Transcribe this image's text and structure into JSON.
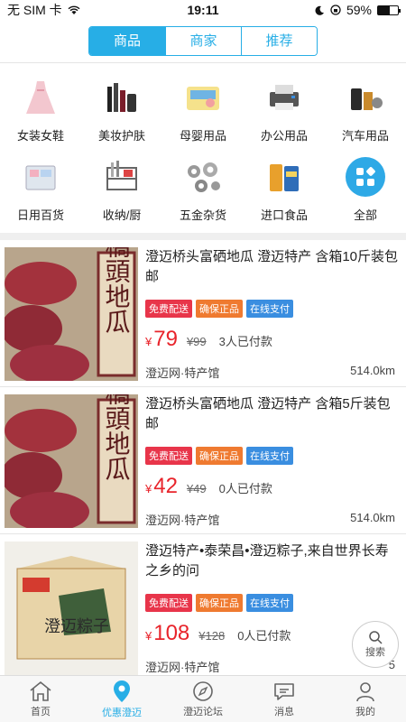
{
  "status_bar": {
    "carrier": "无 SIM 卡",
    "time": "19:11",
    "battery": "59%",
    "battery_level": 0.59
  },
  "segments": [
    {
      "label": "商品",
      "active": true
    },
    {
      "label": "商家",
      "active": false
    },
    {
      "label": "推荐",
      "active": false
    }
  ],
  "categories": [
    {
      "label": "女装女鞋",
      "icon": "dress-image"
    },
    {
      "label": "美妆护肤",
      "icon": "cosmetics-image"
    },
    {
      "label": "母婴用品",
      "icon": "diapers-image"
    },
    {
      "label": "办公用品",
      "icon": "printer-image"
    },
    {
      "label": "汽车用品",
      "icon": "car-accessories-image"
    },
    {
      "label": "日用百货",
      "icon": "storage-box-image"
    },
    {
      "label": "收纳/厨",
      "icon": "kitchen-rack-image"
    },
    {
      "label": "五金杂货",
      "icon": "bearings-image"
    },
    {
      "label": "进口食品",
      "icon": "biscuits-image"
    },
    {
      "label": "全部",
      "icon": "grid-icon"
    }
  ],
  "products": [
    {
      "title": "澄迈桥头富硒地瓜 澄迈特产 含箱10斤装包邮",
      "tags": [
        "免费配送",
        "确保正品",
        "在线支付"
      ],
      "currency": "¥",
      "price": "79",
      "orig_price": "¥99",
      "paid": "3人已付款",
      "shop": "澄迈网·特产馆",
      "distance": "514.0km",
      "image": "sweet-potato-image",
      "image_text": "橋頭地瓜"
    },
    {
      "title": "澄迈桥头富硒地瓜 澄迈特产 含箱5斤装包邮",
      "tags": [
        "免费配送",
        "确保正品",
        "在线支付"
      ],
      "currency": "¥",
      "price": "42",
      "orig_price": "¥49",
      "paid": "0人已付款",
      "shop": "澄迈网·特产馆",
      "distance": "514.0km",
      "image": "sweet-potato-image",
      "image_text": "橋頭地瓜"
    },
    {
      "title": "澄迈特产•泰荣昌•澄迈粽子,来自世界长寿之乡的问",
      "tags": [
        "免费配送",
        "确保正品",
        "在线支付"
      ],
      "currency": "¥",
      "price": "108",
      "orig_price": "¥128",
      "paid": "0人已付款",
      "shop": "澄迈网·特产馆",
      "distance": "5",
      "image": "zongzi-box-image",
      "image_text": "澄迈粽子"
    }
  ],
  "tag_colors": [
    "#e8354a",
    "#ef7a30",
    "#3a8ee0"
  ],
  "search_fab": {
    "label": "搜索"
  },
  "tabbar": [
    {
      "label": "首页",
      "icon": "home-icon",
      "active": false
    },
    {
      "label": "优惠澄迈",
      "icon": "location-pin-icon",
      "active": true
    },
    {
      "label": "澄迈论坛",
      "icon": "compass-icon",
      "active": false
    },
    {
      "label": "消息",
      "icon": "chat-bubble-icon",
      "active": false
    },
    {
      "label": "我的",
      "icon": "person-icon",
      "active": false
    }
  ]
}
